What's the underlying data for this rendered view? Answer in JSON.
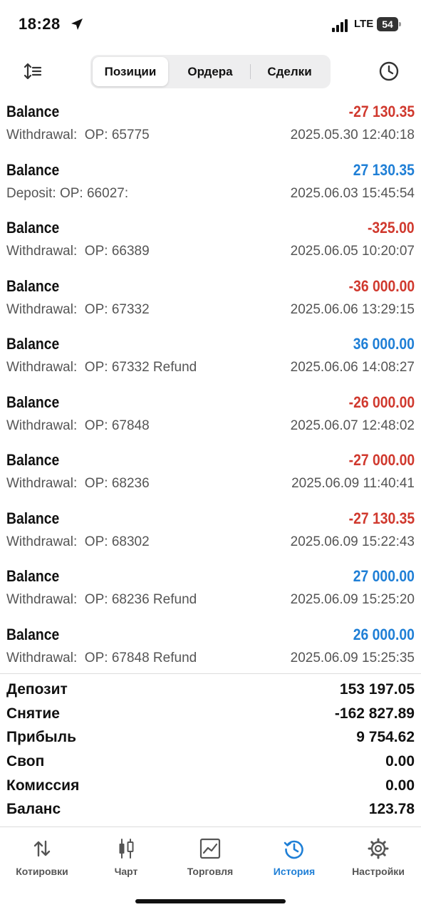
{
  "status_bar": {
    "time": "18:28",
    "network": "LTE",
    "battery": "54"
  },
  "toolbar": {
    "tabs": [
      {
        "label": "Позиции",
        "active": true
      },
      {
        "label": "Ордера",
        "active": false
      },
      {
        "label": "Сделки",
        "active": false
      }
    ]
  },
  "transactions": [
    {
      "title": "Balance",
      "amount": "-27 130.35",
      "type": "negative",
      "description": "Withdrawal:  OP: 65775",
      "date": "2025.05.30 12:40:18"
    },
    {
      "title": "Balance",
      "amount": "27 130.35",
      "type": "positive",
      "description": "Deposit: OP: 66027:",
      "date": "2025.06.03 15:45:54"
    },
    {
      "title": "Balance",
      "amount": "-325.00",
      "type": "negative",
      "description": "Withdrawal:  OP: 66389",
      "date": "2025.06.05 10:20:07"
    },
    {
      "title": "Balance",
      "amount": "-36 000.00",
      "type": "negative",
      "description": "Withdrawal:  OP: 67332",
      "date": "2025.06.06 13:29:15"
    },
    {
      "title": "Balance",
      "amount": "36 000.00",
      "type": "positive",
      "description": "Withdrawal:  OP: 67332 Refund",
      "date": "2025.06.06 14:08:27"
    },
    {
      "title": "Balance",
      "amount": "-26 000.00",
      "type": "negative",
      "description": "Withdrawal:  OP: 67848",
      "date": "2025.06.07 12:48:02"
    },
    {
      "title": "Balance",
      "amount": "-27 000.00",
      "type": "negative",
      "description": "Withdrawal:  OP: 68236",
      "date": "2025.06.09 11:40:41"
    },
    {
      "title": "Balance",
      "amount": "-27 130.35",
      "type": "negative",
      "description": "Withdrawal:  OP: 68302",
      "date": "2025.06.09 15:22:43"
    },
    {
      "title": "Balance",
      "amount": "27 000.00",
      "type": "positive",
      "description": "Withdrawal:  OP: 68236 Refund",
      "date": "2025.06.09 15:25:20"
    },
    {
      "title": "Balance",
      "amount": "26 000.00",
      "type": "positive",
      "description": "Withdrawal:  OP: 67848 Refund",
      "date": "2025.06.09 15:25:35"
    }
  ],
  "summary": [
    {
      "label": "Депозит",
      "value": "153 197.05"
    },
    {
      "label": "Снятие",
      "value": "-162 827.89"
    },
    {
      "label": "Прибыль",
      "value": "9 754.62"
    },
    {
      "label": "Своп",
      "value": "0.00"
    },
    {
      "label": "Комиссия",
      "value": "0.00"
    },
    {
      "label": "Баланс",
      "value": "123.78"
    }
  ],
  "tabbar": {
    "items": [
      {
        "label": "Котировки",
        "icon": "arrows-updown-icon",
        "active": false
      },
      {
        "label": "Чарт",
        "icon": "candlestick-icon",
        "active": false
      },
      {
        "label": "Торговля",
        "icon": "trade-chart-icon",
        "active": false
      },
      {
        "label": "История",
        "icon": "history-icon",
        "active": true
      },
      {
        "label": "Настройки",
        "icon": "gear-icon",
        "active": false
      }
    ]
  },
  "colors": {
    "negative": "#d0392e",
    "positive": "#1f7fd6",
    "accent": "#1f7fd6"
  }
}
